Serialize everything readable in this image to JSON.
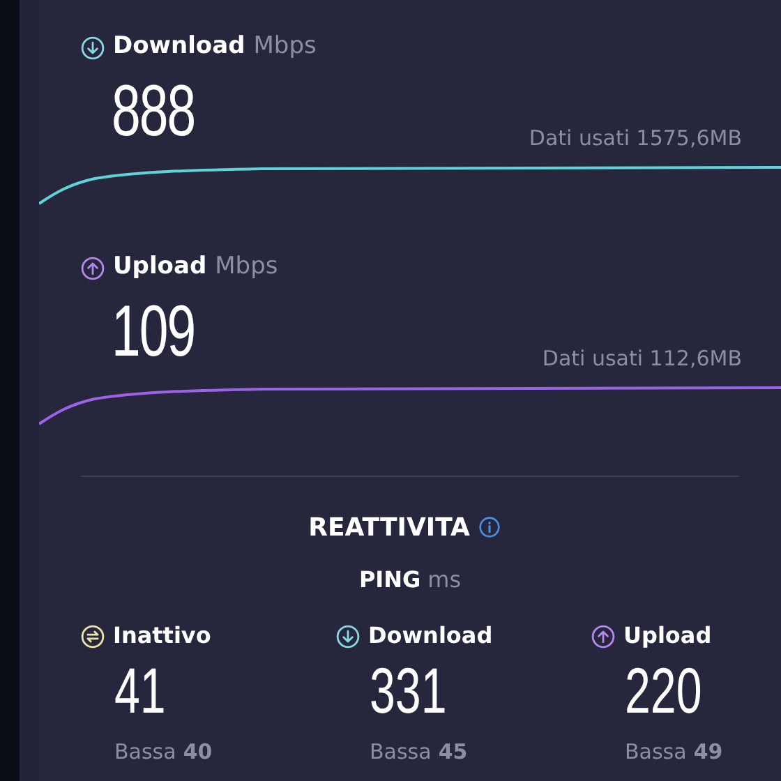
{
  "speed": [
    {
      "kind": "download",
      "label": "Download",
      "unit": "Mbps",
      "value": "888",
      "data_used": "Dati usati 1575,6MB"
    },
    {
      "kind": "upload",
      "label": "Upload",
      "unit": "Mbps",
      "value": "109",
      "data_used": "Dati usati 112,6MB"
    }
  ],
  "responsiveness": {
    "title": "REATTIVITA",
    "ping_label": "PING",
    "ping_unit": "ms",
    "columns": [
      {
        "kind": "idle",
        "label": "Inattivo",
        "value": "41",
        "low_label": "Bassa",
        "low_value": "40"
      },
      {
        "kind": "download",
        "label": "Download",
        "value": "331",
        "low_label": "Bassa",
        "low_value": "45"
      },
      {
        "kind": "upload",
        "label": "Upload",
        "value": "220",
        "low_label": "Bassa",
        "low_value": "49"
      }
    ]
  }
}
